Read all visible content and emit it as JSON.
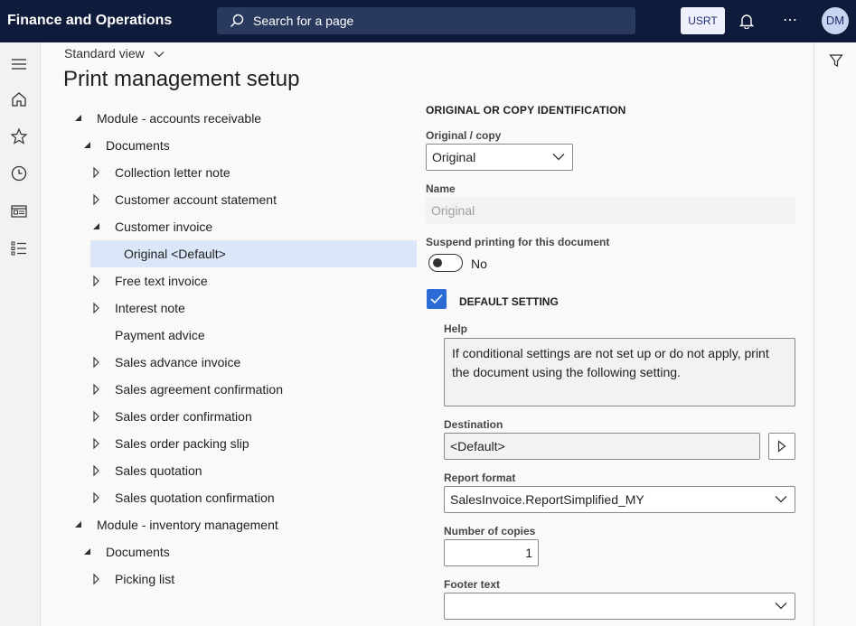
{
  "app": {
    "title": "Finance and Operations",
    "search_placeholder": "Search for a page",
    "company": "USRT",
    "more": "⋯",
    "user_initials": "DM"
  },
  "nav": {
    "icons": [
      "hamburger-icon",
      "home-icon",
      "star-icon",
      "clock-icon",
      "workspace-icon",
      "list-icon"
    ]
  },
  "header": {
    "view_label": "Standard view",
    "page_title": "Print management setup"
  },
  "tree": [
    {
      "label": "Module - accounts receivable",
      "state": "expanded"
    },
    {
      "label": "Documents",
      "state": "expanded"
    },
    {
      "label": "Collection letter note",
      "state": "collapsed"
    },
    {
      "label": "Customer account statement",
      "state": "collapsed"
    },
    {
      "label": "Customer invoice",
      "state": "expanded"
    },
    {
      "label": "Original <Default>",
      "state": "leaf",
      "selected": true
    },
    {
      "label": "Free text invoice",
      "state": "collapsed"
    },
    {
      "label": "Interest note",
      "state": "collapsed"
    },
    {
      "label": "Payment advice",
      "state": "leaf"
    },
    {
      "label": "Sales advance invoice",
      "state": "collapsed"
    },
    {
      "label": "Sales agreement confirmation",
      "state": "collapsed"
    },
    {
      "label": "Sales order confirmation",
      "state": "collapsed"
    },
    {
      "label": "Sales order packing slip",
      "state": "collapsed"
    },
    {
      "label": "Sales quotation",
      "state": "collapsed"
    },
    {
      "label": "Sales quotation confirmation",
      "state": "collapsed"
    },
    {
      "label": "Module - inventory management",
      "state": "expanded"
    },
    {
      "label": "Documents",
      "state": "expanded"
    },
    {
      "label": "Picking list",
      "state": "collapsed"
    }
  ],
  "form": {
    "section_title": "ORIGINAL OR COPY IDENTIFICATION",
    "original_copy_label": "Original / copy",
    "original_copy_value": "Original",
    "name_label": "Name",
    "name_value": "Original",
    "suspend_label": "Suspend printing for this document",
    "suspend_value": "No",
    "default_setting_label": "DEFAULT SETTING",
    "default_setting_checked": true,
    "help_label": "Help",
    "help_text": "If conditional settings are not set up or do not apply, print the document using the following setting.",
    "destination_label": "Destination",
    "destination_value": "<Default>",
    "report_format_label": "Report format",
    "report_format_value": "SalesInvoice.ReportSimplified_MY",
    "copies_label": "Number of copies",
    "copies_value": "1",
    "footer_label": "Footer text",
    "footer_value": ""
  }
}
